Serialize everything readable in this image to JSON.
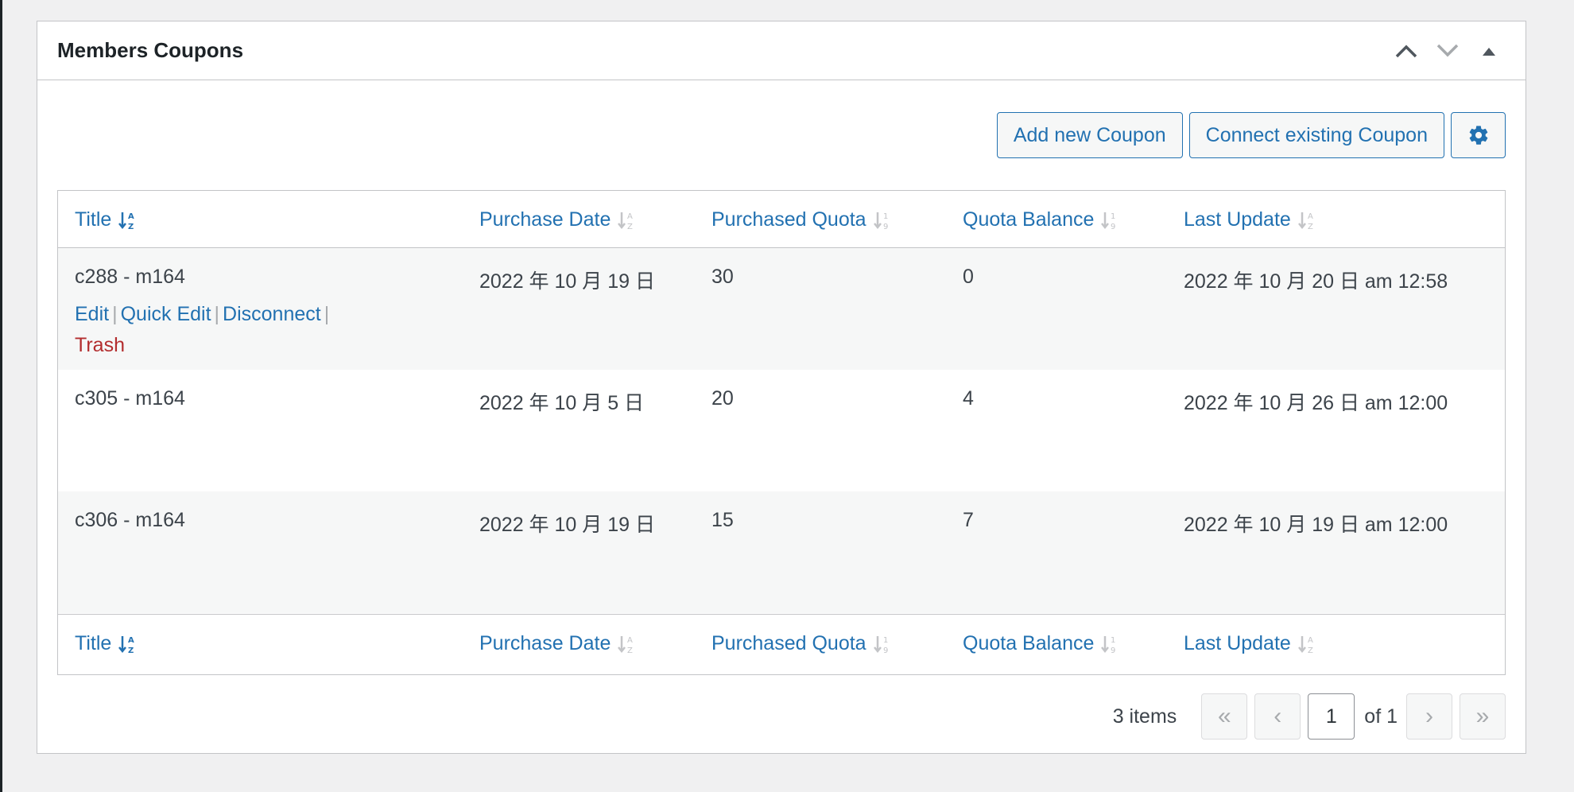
{
  "panel": {
    "title": "Members Coupons"
  },
  "header_icons": [
    "chevron-up-icon",
    "chevron-down-icon",
    "triangle-up-icon"
  ],
  "actions": {
    "add_new": "Add new Coupon",
    "connect_existing": "Connect existing Coupon",
    "settings_icon": "gear-icon"
  },
  "columns": {
    "title": "Title",
    "purchase_date": "Purchase Date",
    "purchased_quota": "Purchased Quota",
    "quota_balance": "Quota Balance",
    "last_update": "Last Update"
  },
  "rows": [
    {
      "title": "c288 - m164",
      "purchase_date": "2022 年 10 月 19 日",
      "purchased_quota": "30",
      "quota_balance": "0",
      "last_update": "2022 年 10 月 20 日 am 12:58"
    },
    {
      "title": "c305 - m164",
      "purchase_date": "2022 年 10 月 5 日",
      "purchased_quota": "20",
      "quota_balance": "4",
      "last_update": "2022 年 10 月 26 日 am 12:00"
    },
    {
      "title": "c306 - m164",
      "purchase_date": "2022 年 10 月 19 日",
      "purchased_quota": "15",
      "quota_balance": "7",
      "last_update": "2022 年 10 月 19 日 am 12:00"
    }
  ],
  "row_actions": {
    "edit": "Edit",
    "quick_edit": "Quick Edit",
    "disconnect": "Disconnect",
    "trash": "Trash",
    "separator": "|"
  },
  "pagination": {
    "items": "3 items",
    "first": "«",
    "prev": "‹",
    "current_page": "1",
    "of_total": "of 1",
    "next": "›",
    "last": "»"
  },
  "colors": {
    "link": "#2271b1",
    "trash": "#b32d2e",
    "border": "#c3c4c7",
    "alt_row": "#f6f7f7"
  }
}
